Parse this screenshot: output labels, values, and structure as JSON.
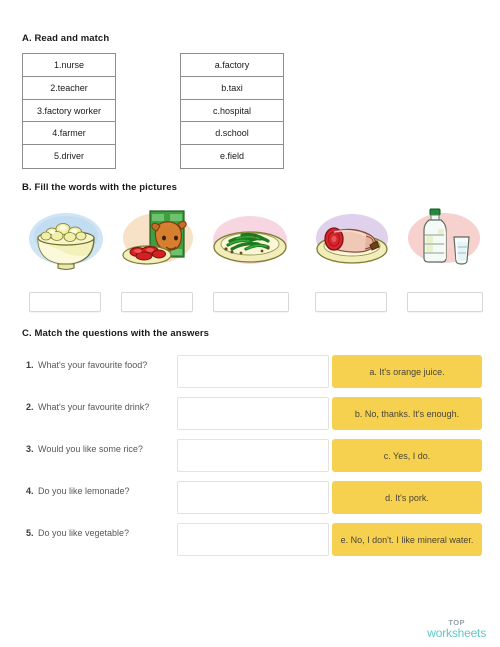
{
  "sections": {
    "a": {
      "heading": "A. Read and match",
      "left_column": [
        "1.nurse",
        "2.teacher",
        "3.factory worker",
        "4.farmer",
        "5.driver"
      ],
      "right_column": [
        "a.factory",
        "b.taxi",
        "c.hospital",
        "d.school",
        "e.field"
      ]
    },
    "b": {
      "heading": "B. Fill the words with the pictures",
      "pictures": [
        {
          "icon": "rice-bowl-icon",
          "answer_value": "",
          "placeholder": ""
        },
        {
          "icon": "beef-meat-icon",
          "answer_value": "",
          "placeholder": ""
        },
        {
          "icon": "green-beans-plate-icon",
          "answer_value": "",
          "placeholder": ""
        },
        {
          "icon": "pork-roll-plate-icon",
          "answer_value": "",
          "placeholder": ""
        },
        {
          "icon": "water-bottle-glass-icon",
          "answer_value": "",
          "placeholder": ""
        }
      ]
    },
    "c": {
      "heading": "C. Match the questions with the answers",
      "rows": [
        {
          "number": "1.",
          "question": "What's your favourite food?",
          "input_value": "",
          "answer": "a. It's orange juice."
        },
        {
          "number": "2.",
          "question": "What's your favourite drink?",
          "input_value": "",
          "answer": "b. No, thanks. It's enough."
        },
        {
          "number": "3.",
          "question": "Would you like some rice?",
          "input_value": "",
          "answer": "c. Yes, I do."
        },
        {
          "number": "4.",
          "question": "Do you like lemonade?",
          "input_value": "",
          "answer": "d. It's pork."
        },
        {
          "number": "5.",
          "question": "Do you like vegetable?",
          "input_value": "",
          "answer": "e. No, I don't. I like mineral water."
        }
      ]
    }
  },
  "footer": {
    "logo_top": "TOP",
    "logo_bottom": "worksheets"
  },
  "colors": {
    "answer_yellow": "#f6d14f",
    "logo_teal": "#5ec9c9",
    "logo_gray": "#9aa0a6",
    "table_border": "#8d8d8d"
  }
}
